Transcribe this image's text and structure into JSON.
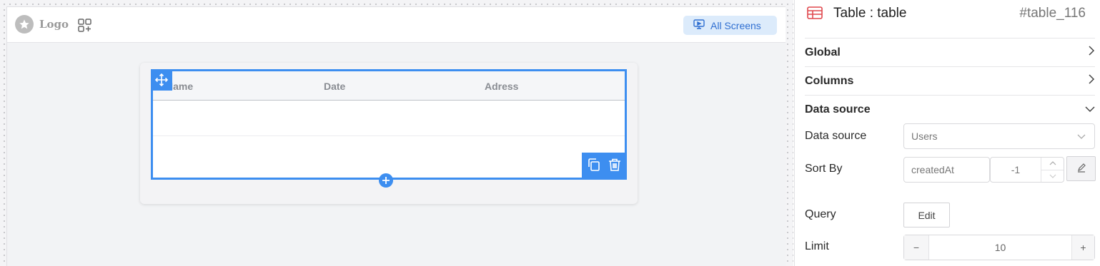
{
  "topbar": {
    "logo_label": "Logo",
    "logo_icon": "star-icon",
    "apps_icon": "add-widget-icon",
    "screens_button_label": "All Screens",
    "screens_icon": "screen-icon"
  },
  "table_widget": {
    "columns": [
      "Name",
      "Date",
      "Adress"
    ],
    "rows": [
      [
        "",
        "",
        ""
      ],
      [
        "",
        "",
        ""
      ]
    ],
    "accent_color": "#3d8ef0"
  },
  "panel": {
    "title": "Table : table",
    "id": "#table_116",
    "sections": {
      "global": "Global",
      "columns": "Columns",
      "data_source": "Data source"
    },
    "data_source_label": "Data source",
    "data_source_value": "Users",
    "sort_by_label": "Sort By",
    "sort_field_value": "createdAt",
    "sort_direction_value": "-1",
    "query_label": "Query",
    "query_button": "Edit",
    "limit_label": "Limit",
    "limit_value": "10",
    "limit_minus": "−",
    "limit_plus": "+"
  }
}
